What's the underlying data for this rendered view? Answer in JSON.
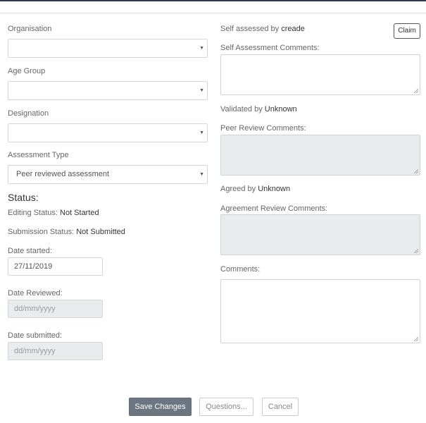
{
  "form": {
    "organisation": {
      "label": "Organisation",
      "value": ""
    },
    "age_group": {
      "label": "Age Group",
      "value": ""
    },
    "designation": {
      "label": "Designation",
      "value": ""
    },
    "assessment_type": {
      "label": "Assessment Type",
      "value": "Peer reviewed assessment"
    }
  },
  "status": {
    "heading": "Status:",
    "editing_label": "Editing Status:",
    "editing_value": "Not Started",
    "submission_label": "Submission Status:",
    "submission_value": "Not Submitted"
  },
  "dates": {
    "started_label": "Date started:",
    "started_value": "27/11/2019",
    "reviewed_label": "Date Reviewed:",
    "reviewed_placeholder": "dd/mm/yyyy",
    "submitted_label": "Date submitted:",
    "submitted_placeholder": "dd/mm/yyyy"
  },
  "right": {
    "self_assessed_label": "Self assessed by",
    "self_assessed_user": "creade",
    "claim_button": "Claim",
    "self_comments_label": "Self Assessment Comments:",
    "validated_label": "Validated by",
    "validated_user": "Unknown",
    "peer_comments_label": "Peer Review Comments:",
    "agreed_label": "Agreed by",
    "agreed_user": "Unknown",
    "agreement_comments_label": "Agreement Review Comments:",
    "comments_label": "Comments:"
  },
  "actions": {
    "save": "Save Changes",
    "questions": "Questions...",
    "cancel": "Cancel"
  },
  "icons": {
    "caret": "caret-down-icon"
  }
}
